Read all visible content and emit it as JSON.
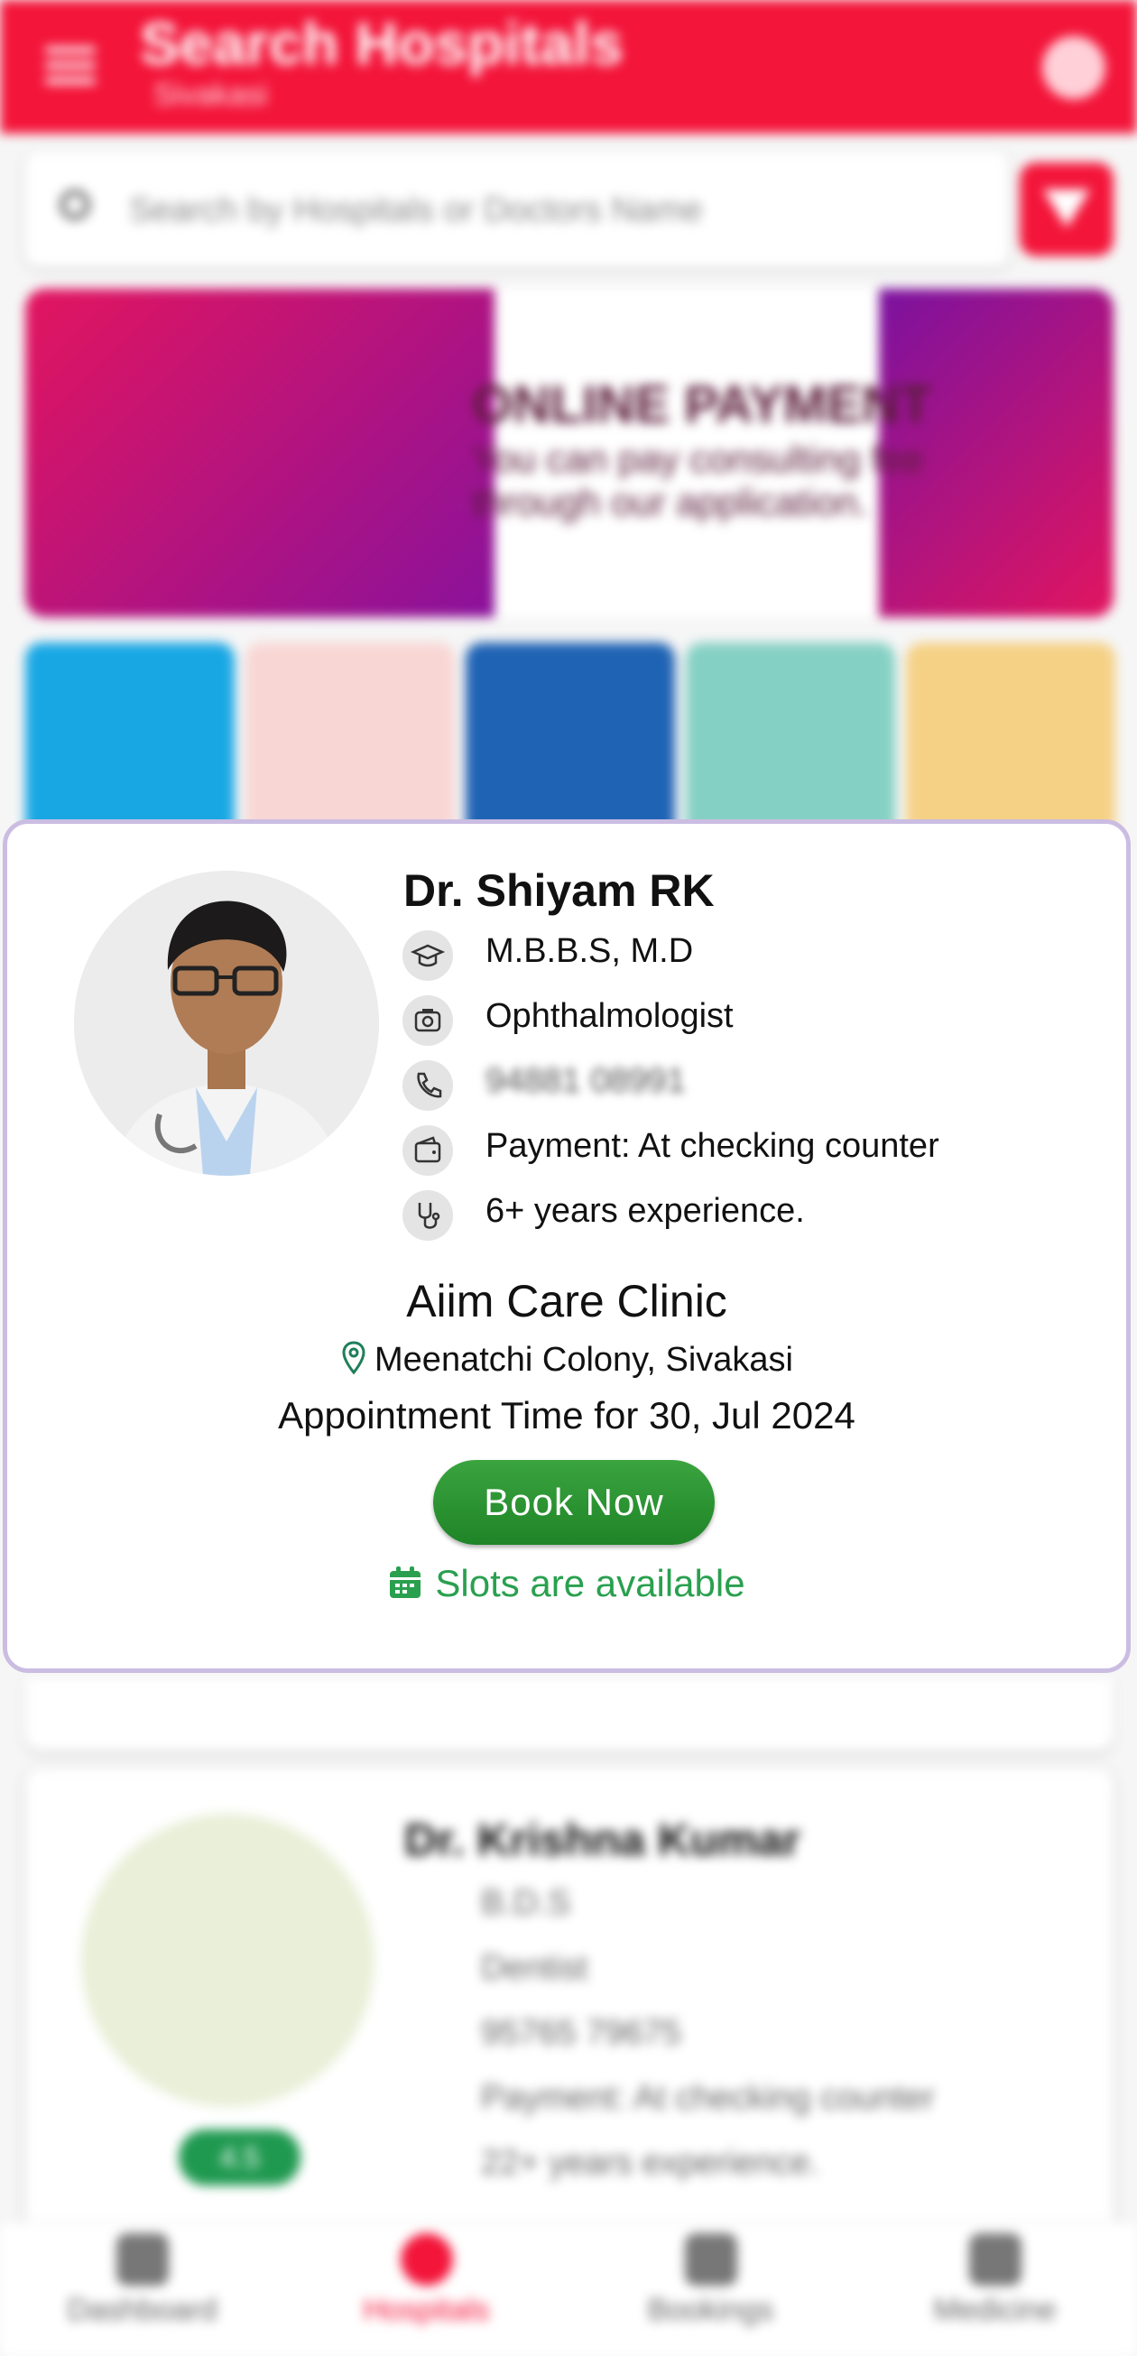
{
  "header": {
    "title": "Search Hospitals",
    "location": "Sivakasi"
  },
  "search": {
    "placeholder": "Search by Hospitals or Doctors Name"
  },
  "banner": {
    "heading": "ONLINE PAYMENT",
    "text": "You can pay consulting fee through our application."
  },
  "doctor_card": {
    "name": "Dr. Shiyam RK",
    "qualification": "M.B.B.S, M.D",
    "specialty": "Ophthalmologist",
    "phone": "94881 08991",
    "payment": "Payment: At checking counter",
    "experience": "6+ years experience.",
    "clinic": "Aiim Care Clinic",
    "address": "Meenatchi Colony, Sivakasi",
    "appointment": "Appointment Time for 30, Jul 2024",
    "book_label": "Book Now",
    "slots": "Slots are available"
  },
  "next_card": {
    "name": "Dr. Krishna Kumar",
    "qualification": "B.D.S",
    "specialty": "Dentist",
    "phone": "95765 79675",
    "payment": "Payment: At checking counter",
    "experience": "22+ years experience.",
    "rating": "4.5"
  },
  "bottom_nav": [
    "Dashboard",
    "Hospitals",
    "Bookings",
    "Medicine"
  ],
  "colors": {
    "primary": "#f3153a",
    "success": "#2aa04f",
    "focus_border": "#cbbde2"
  }
}
